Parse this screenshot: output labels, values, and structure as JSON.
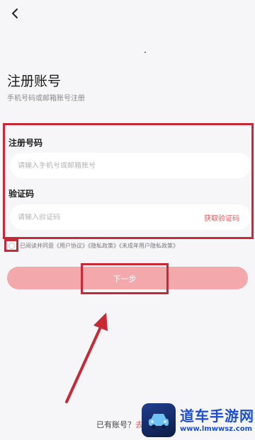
{
  "header": {
    "back_icon": "chevron-left-icon"
  },
  "page": {
    "title": "注册账号",
    "subtitle": "手机号码或邮箱账号注册"
  },
  "form": {
    "phone_label": "注册号码",
    "phone_placeholder": "请输入手机号或邮箱账号",
    "code_label": "验证码",
    "code_placeholder": "请输入验证码",
    "get_code_label": "获取验证码"
  },
  "agreement": {
    "text": "已阅读并同意《用户协议》《隐私政策》《未成年用户隐私政策》"
  },
  "next_button": {
    "label": "下一步"
  },
  "footer": {
    "have_account_text": "已有账号？",
    "login_link_text": "去"
  },
  "watermark": {
    "title": "道车手游网",
    "url": "www.lmwwsz.com"
  },
  "colors": {
    "accent": "#e35a5a",
    "annotation_red": "#c52a36",
    "button_disabled": "#f3a8ab",
    "background": "#f6f5f7"
  }
}
